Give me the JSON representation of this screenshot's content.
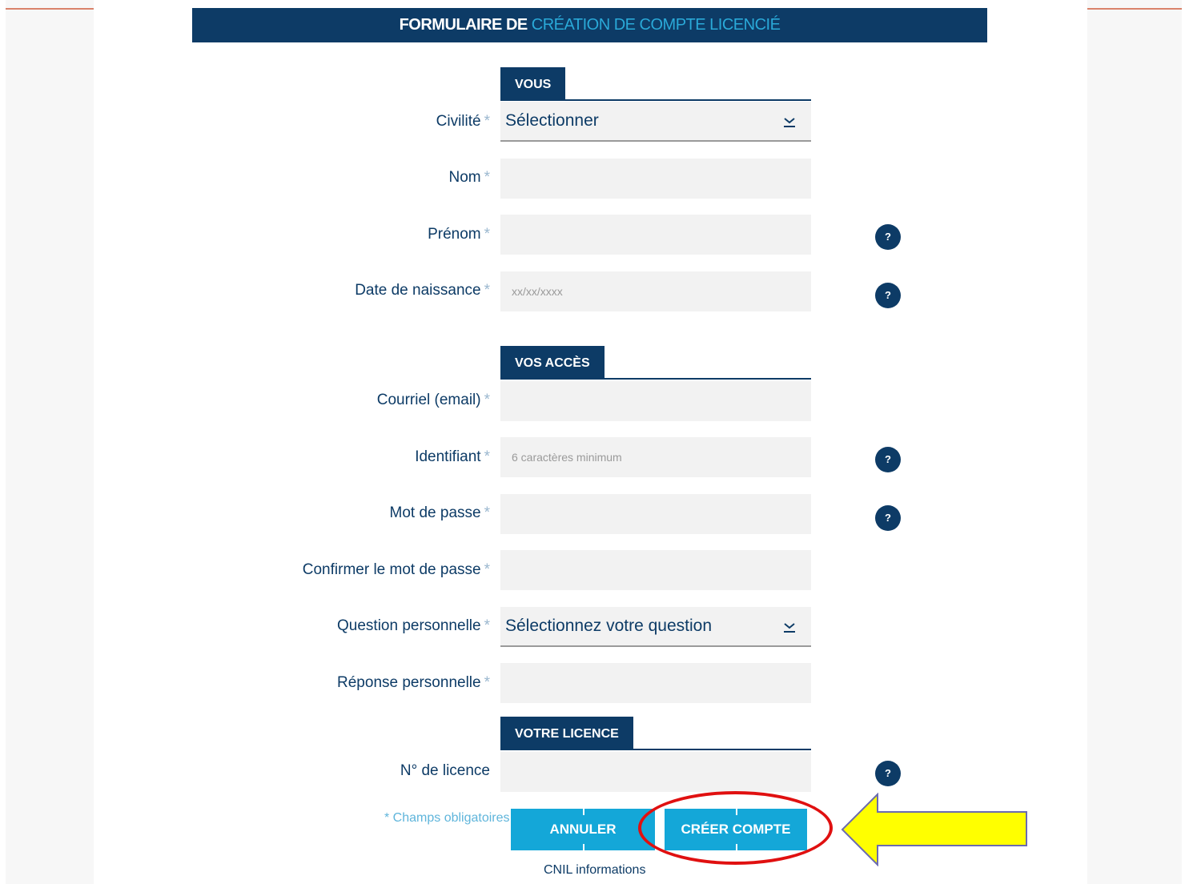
{
  "header": {
    "title_prefix": "FORMULAIRE DE",
    "title_highlight": "CRÉATION DE COMPTE LICENCIÉ"
  },
  "sections": {
    "vous": "VOUS",
    "acces": "VOS ACCÈS",
    "licence": "VOTRE LICENCE"
  },
  "required_marker": "*",
  "fields": {
    "civilite": {
      "label": "Civilité",
      "value": "Sélectionner"
    },
    "nom": {
      "label": "Nom",
      "placeholder": ""
    },
    "prenom": {
      "label": "Prénom",
      "placeholder": ""
    },
    "naissance": {
      "label": "Date de naissance",
      "placeholder": "xx/xx/xxxx"
    },
    "courriel": {
      "label": "Courriel (email)",
      "placeholder": ""
    },
    "identifiant": {
      "label": "Identifiant",
      "placeholder": "6 caractères minimum"
    },
    "motdepasse": {
      "label": "Mot de passe",
      "placeholder": ""
    },
    "confirmer": {
      "label": "Confirmer le mot de passe",
      "placeholder": ""
    },
    "question": {
      "label": "Question personnelle",
      "value": "Sélectionnez votre question"
    },
    "reponse": {
      "label": "Réponse personnelle",
      "placeholder": ""
    },
    "licence": {
      "label": "N° de licence",
      "placeholder": ""
    }
  },
  "help_icon_text": "?",
  "footer": {
    "mandatory_note": "* Champs obligatoires",
    "cancel_label": "ANNULER",
    "create_label": "CRÉER COMPTE",
    "cnil_link": "CNIL informations"
  },
  "colors": {
    "navy": "#0d3b66",
    "accent": "#14a7d8",
    "annotation_circle": "#e01010",
    "annotation_arrow": "#ffff00"
  }
}
